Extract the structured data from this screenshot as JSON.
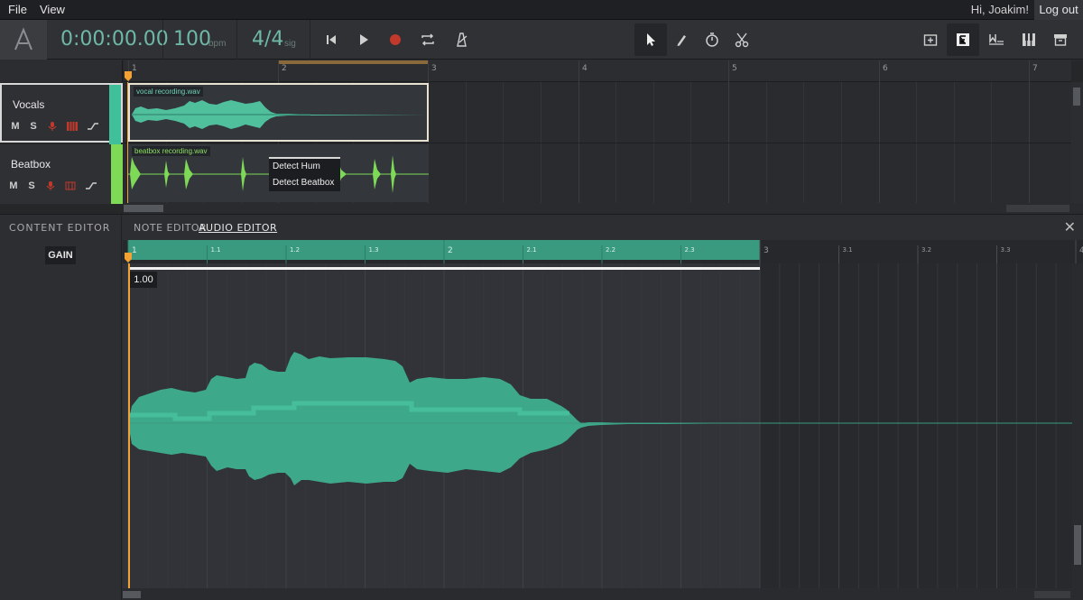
{
  "menu": {
    "file": "File",
    "view": "View",
    "greeting": "Hi, Joakim!",
    "logout": "Log out"
  },
  "transport": {
    "time": "0:00:00.00",
    "tempo": "100",
    "tempo_unit": "bpm",
    "signature": "4/4",
    "signature_unit": "sig"
  },
  "toolbar_icons": {
    "transport": [
      "skip-back-icon",
      "play-icon",
      "record-icon",
      "loop-icon",
      "metronome-icon"
    ],
    "tools": [
      "pointer-icon",
      "pencil-icon",
      "timer-icon",
      "scissors-icon"
    ],
    "views": [
      "add-track-icon",
      "editor-icon",
      "score-icon",
      "piano-icon",
      "archive-icon"
    ]
  },
  "colors": {
    "accent": "#6fb8a8",
    "vocals": "#3fbf9a",
    "beatbox": "#7ed957",
    "record": "#c0392b",
    "playhead": "#f2a234"
  },
  "ruler": {
    "bars": [
      "1",
      "2",
      "3",
      "4",
      "5",
      "6",
      "7"
    ]
  },
  "tracks": [
    {
      "name": "Vocals",
      "mute": "M",
      "solo": "S",
      "clip": "vocal recording.wav"
    },
    {
      "name": "Beatbox",
      "mute": "M",
      "solo": "S",
      "clip": "beatbox recording.wav"
    }
  ],
  "context_menu": [
    "Detect Hum",
    "Detect Beatbox"
  ],
  "editor": {
    "title": "CONTENT EDITOR",
    "gain_button": "GAIN",
    "tabs": [
      "NOTE EDITOR",
      "AUDIO EDITOR"
    ],
    "active_tab": "AUDIO EDITOR",
    "close": "✕",
    "ruler_labels": [
      "1",
      "1.1",
      "1.2",
      "1.3",
      "2",
      "2.1",
      "2.2",
      "2.3",
      "3",
      "3.1",
      "3.2",
      "3.3",
      "4"
    ],
    "gain_value": "1.00"
  }
}
